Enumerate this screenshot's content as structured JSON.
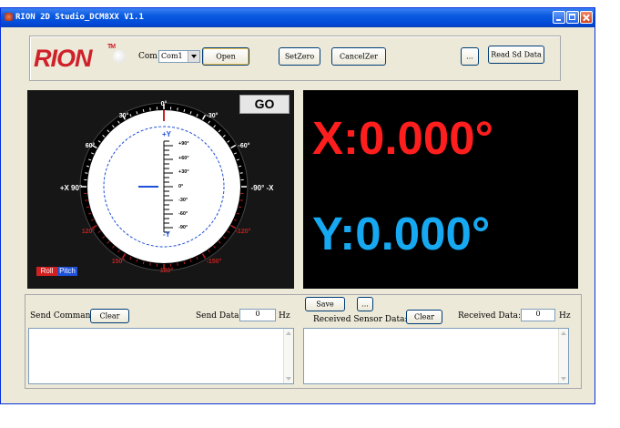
{
  "window": {
    "title": "RION 2D Studio_DCM8XX V1.1"
  },
  "toolbar": {
    "logo": "RION",
    "logo_tm": "TM",
    "com_label": "Com",
    "com_value": "Com1",
    "open_label": "Open",
    "setzero_label": "SetZero",
    "cancelzero_label": "CancelZer",
    "browse_label": "...",
    "read_sd_label": "Read Sd Data"
  },
  "gauge": {
    "go_label": "GO",
    "roll_label": "Roll",
    "pitch_label": "Pitch",
    "roll_marks": [
      "0°",
      "30°",
      "-30°",
      "60°",
      "-60°",
      "+X 90°",
      "-90° -X",
      "120°",
      "-120°",
      "150°",
      "-150°",
      "180°"
    ],
    "pitch_marks": [
      "+Y",
      "+90°",
      "+60°",
      "+30°",
      "0°",
      "-30°",
      "-60°",
      "-90°",
      "-Y"
    ],
    "colors": {
      "roll": "#d02020",
      "pitch": "#1e50d8"
    }
  },
  "readout": {
    "x_value": "X:0.000°",
    "y_value": "Y:0.000°",
    "colors": {
      "x": "#ff1e1e",
      "y": "#16a8f0"
    }
  },
  "send": {
    "label": "Send Command:",
    "clear_label": "Clear",
    "data_label": "Send Data:",
    "data_value": "0",
    "unit": "Hz"
  },
  "receive": {
    "save_label": "Save",
    "browse_label": "...",
    "label": "Received Sensor Data:",
    "clear_label": "Clear",
    "data_label": "Received Data:",
    "data_value": "0",
    "unit": "Hz"
  }
}
